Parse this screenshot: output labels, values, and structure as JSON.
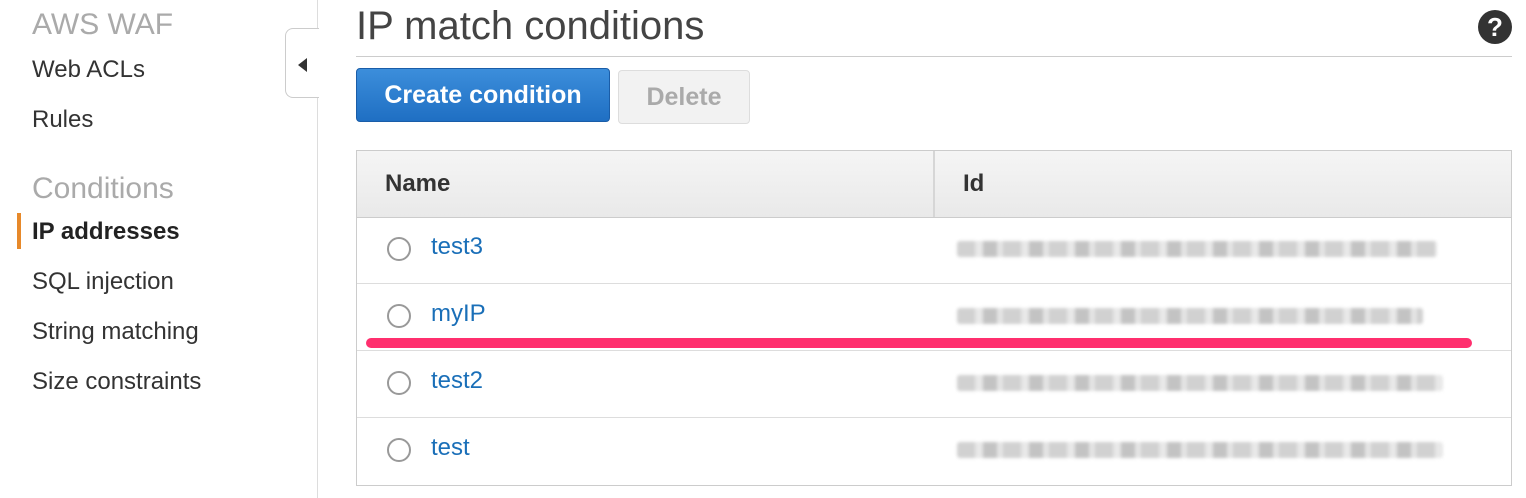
{
  "sidebar": {
    "section1_title": "AWS WAF",
    "items1": [
      {
        "label": "Web ACLs"
      },
      {
        "label": "Rules"
      }
    ],
    "section2_title": "Conditions",
    "items2": [
      {
        "label": "IP addresses",
        "active": true
      },
      {
        "label": "SQL injection"
      },
      {
        "label": "String matching"
      },
      {
        "label": "Size constraints"
      }
    ]
  },
  "main": {
    "title": "IP match conditions",
    "help_label": "?",
    "buttons": {
      "create_label": "Create condition",
      "delete_label": "Delete"
    },
    "table": {
      "columns": [
        "Name",
        "Id"
      ],
      "rows": [
        {
          "name": "test3",
          "id_blurred": true
        },
        {
          "name": "myIP",
          "id_blurred": true
        },
        {
          "name": "test2",
          "id_blurred": true
        },
        {
          "name": "test",
          "id_blurred": true
        }
      ]
    }
  },
  "colors": {
    "accent": "#e7892a",
    "primary_button": "#1f6fc3",
    "link": "#1a6fb8",
    "highlight_line": "#ff2f6e"
  },
  "icons": {
    "collapse": "chevron-left-icon",
    "help": "help-icon"
  }
}
